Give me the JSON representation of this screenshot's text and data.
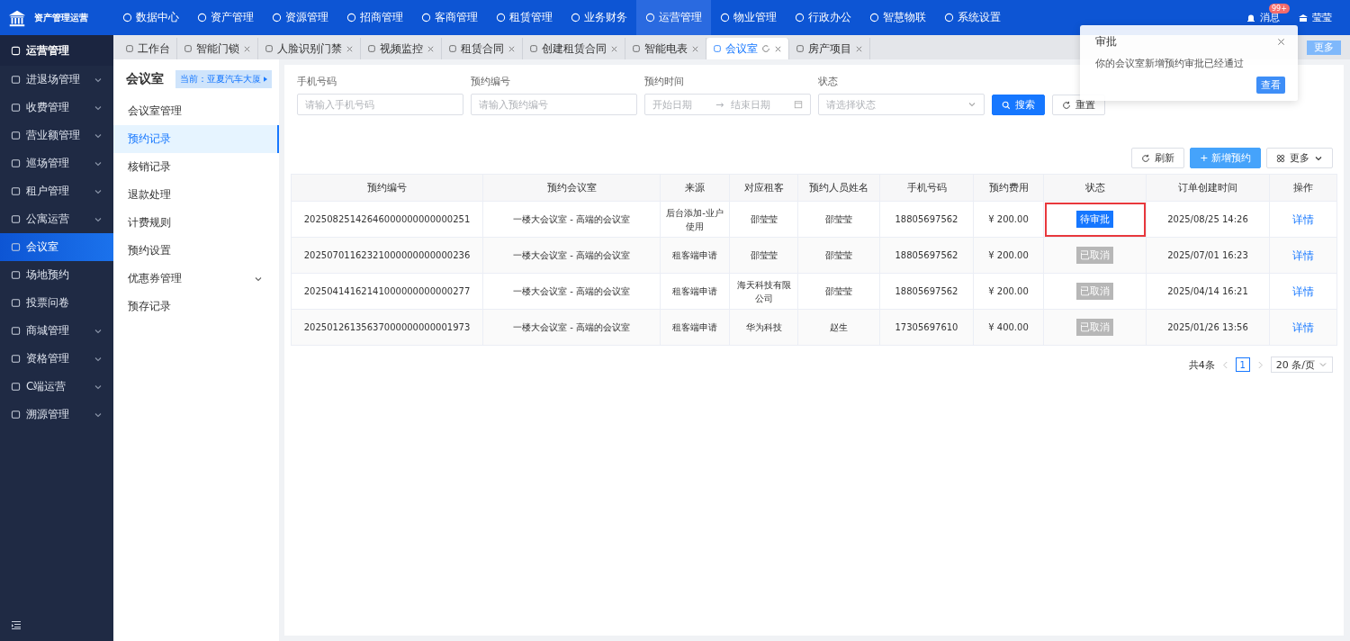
{
  "app": {
    "title": "资产管理运营"
  },
  "top_nav": [
    {
      "label": "数据中心",
      "selected": false
    },
    {
      "label": "资产管理",
      "selected": false
    },
    {
      "label": "资源管理",
      "selected": false
    },
    {
      "label": "招商管理",
      "selected": false
    },
    {
      "label": "客商管理",
      "selected": false
    },
    {
      "label": "租赁管理",
      "selected": false
    },
    {
      "label": "业务财务",
      "selected": false
    },
    {
      "label": "运营管理",
      "selected": true
    },
    {
      "label": "物业管理",
      "selected": false
    },
    {
      "label": "行政办公",
      "selected": false
    },
    {
      "label": "智慧物联",
      "selected": false
    },
    {
      "label": "系统设置",
      "selected": false
    }
  ],
  "header_right": {
    "messages": {
      "label": "消息",
      "badge": "99+"
    },
    "user": {
      "name": "莹莹"
    }
  },
  "tabs": [
    {
      "label": "工作台",
      "selected": false,
      "closable": false
    },
    {
      "label": "智能门锁",
      "selected": false,
      "closable": true
    },
    {
      "label": "人脸识别门禁",
      "selected": false,
      "closable": true
    },
    {
      "label": "视频监控",
      "selected": false,
      "closable": true
    },
    {
      "label": "租赁合同",
      "selected": false,
      "closable": true
    },
    {
      "label": "创建租赁合同",
      "selected": false,
      "closable": true
    },
    {
      "label": "智能电表",
      "selected": false,
      "closable": true
    },
    {
      "label": "会议室",
      "selected": true,
      "closable": true
    },
    {
      "label": "房产项目",
      "selected": false,
      "closable": true
    }
  ],
  "tabs_more": "更多",
  "sidebar": {
    "title": "运营管理",
    "items": [
      {
        "label": "进退场管理",
        "selected": false,
        "has_children": true
      },
      {
        "label": "收费管理",
        "selected": false,
        "has_children": true
      },
      {
        "label": "营业额管理",
        "selected": false,
        "has_children": true
      },
      {
        "label": "巡场管理",
        "selected": false,
        "has_children": true
      },
      {
        "label": "租户管理",
        "selected": false,
        "has_children": true
      },
      {
        "label": "公寓运营",
        "selected": false,
        "has_children": true
      },
      {
        "label": "会议室",
        "selected": true,
        "has_children": false
      },
      {
        "label": "场地预约",
        "selected": false,
        "has_children": false
      },
      {
        "label": "投票问卷",
        "selected": false,
        "has_children": false
      },
      {
        "label": "商城管理",
        "selected": false,
        "has_children": true
      },
      {
        "label": "资格管理",
        "selected": false,
        "has_children": true
      },
      {
        "label": "C端运营",
        "selected": false,
        "has_children": true
      },
      {
        "label": "溯源管理",
        "selected": false,
        "has_children": true
      }
    ]
  },
  "submenu": {
    "title": "会议室",
    "building": "当前：亚夏汽车大厦",
    "items": [
      {
        "label": "会议室管理",
        "selected": false,
        "has_children": false
      },
      {
        "label": "预约记录",
        "selected": true,
        "has_children": false
      },
      {
        "label": "核销记录",
        "selected": false,
        "has_children": false
      },
      {
        "label": "退款处理",
        "selected": false,
        "has_children": false
      },
      {
        "label": "计费规则",
        "selected": false,
        "has_children": false
      },
      {
        "label": "预约设置",
        "selected": false,
        "has_children": false
      },
      {
        "label": "优惠券管理",
        "selected": false,
        "has_children": true
      },
      {
        "label": "预存记录",
        "selected": false,
        "has_children": false
      }
    ]
  },
  "filters": [
    {
      "label": "手机号码",
      "kind": "text",
      "placeholder": "请输入手机号码"
    },
    {
      "label": "预约编号",
      "kind": "text",
      "placeholder": "请输入预约编号"
    },
    {
      "label": "预约时间",
      "kind": "daterange",
      "start_placeholder": "开始日期",
      "separator": "→",
      "end_placeholder": "结束日期"
    },
    {
      "label": "状态",
      "kind": "select",
      "placeholder": "请选择状态"
    }
  ],
  "search_button": "搜索",
  "reset_button": "重置",
  "toolbar": {
    "refresh": "刷新",
    "add": "+ 新增预约",
    "more": "更多"
  },
  "table": {
    "columns": [
      "预约编号",
      "预约会议室",
      "来源",
      "对应租客",
      "预约人员姓名",
      "手机号码",
      "预约费用",
      "状态",
      "订单创建时间",
      "操作"
    ],
    "rows": [
      {
        "id": "20250825142646000000000000251",
        "room": "一楼大会议室 - 高端的会议室",
        "source": "后台添加-业户使用",
        "tenant": "邵莹莹",
        "person": "邵莹莹",
        "phone": "18805697562",
        "fee": "¥ 200.00",
        "status": {
          "text": "待审批",
          "kind": "pending"
        },
        "highlighted": true,
        "created": "2025/08/25 14:26",
        "action": "详情"
      },
      {
        "id": "20250701162321000000000000236",
        "room": "一楼大会议室 - 高端的会议室",
        "source": "租客端申请",
        "tenant": "邵莹莹",
        "person": "邵莹莹",
        "phone": "18805697562",
        "fee": "¥ 200.00",
        "status": {
          "text": "已取消",
          "kind": "cancelled"
        },
        "highlighted": false,
        "created": "2025/07/01 16:23",
        "action": "详情"
      },
      {
        "id": "20250414162141000000000000277",
        "room": "一楼大会议室 - 高端的会议室",
        "source": "租客端申请",
        "tenant": "海天科技有限公司",
        "person": "邵莹莹",
        "phone": "18805697562",
        "fee": "¥ 200.00",
        "status": {
          "text": "已取消",
          "kind": "cancelled"
        },
        "highlighted": false,
        "created": "2025/04/14 16:21",
        "action": "详情"
      },
      {
        "id": "20250126135637000000000001973",
        "room": "一楼大会议室 - 高端的会议室",
        "source": "租客端申请",
        "tenant": "华为科技",
        "person": "赵生",
        "phone": "17305697610",
        "fee": "¥ 400.00",
        "status": {
          "text": "已取消",
          "kind": "cancelled"
        },
        "highlighted": false,
        "created": "2025/01/26 13:56",
        "action": "详情"
      }
    ]
  },
  "pagination": {
    "total": "共4条",
    "pages": [
      {
        "label": "1",
        "selected": true
      }
    ],
    "page_size": "20 条/页"
  },
  "notification": {
    "title": "审批",
    "message": "你的会议室新增预约审批已经通过",
    "action": "查看"
  }
}
